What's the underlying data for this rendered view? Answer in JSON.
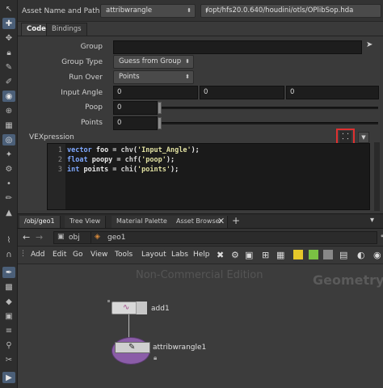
{
  "header": {
    "asset_label": "Asset Name and Path",
    "asset_name": "attribwrangle",
    "asset_path": "/opt/hfs20.0.640/houdini/otls/OPlibSop.hda"
  },
  "tabs": [
    {
      "label": "Code",
      "active": true
    },
    {
      "label": "Bindings",
      "active": false
    }
  ],
  "params": {
    "group_label": "Group",
    "group_value": "",
    "group_type_label": "Group Type",
    "group_type_value": "Guess from Group",
    "run_over_label": "Run Over",
    "run_over_value": "Points",
    "input_angle_label": "Input Angle",
    "input_angle_values": [
      "0",
      "0",
      "0"
    ],
    "poop_label": "Poop",
    "poop_value": "0",
    "points_label": "Points",
    "points_value": "0"
  },
  "vex": {
    "label": "VEXpression",
    "lines": [
      {
        "num": "1",
        "kw": "vector",
        "rest_a": " foo = ",
        "fn": "chv",
        "str": "'Input_Angle'",
        "rest_b": ");"
      },
      {
        "num": "2",
        "kw": "float",
        "rest_a": " poopy = ",
        "fn": "chf",
        "str": "'poop'",
        "rest_b": ");"
      },
      {
        "num": "3",
        "kw": "int",
        "rest_a": " points = ",
        "fn": "chi",
        "str": "'points'",
        "rest_b": ");"
      }
    ]
  },
  "network": {
    "tabs": [
      "/obj/geo1",
      "Tree View",
      "Material Palette",
      "Asset Browser"
    ],
    "path": [
      "obj",
      "geo1"
    ],
    "menu": [
      "Add",
      "Edit",
      "Go",
      "View",
      "Tools",
      "Layout",
      "Labs",
      "Help"
    ],
    "watermark": "Non-Commercial Edition",
    "context_label": "Geometry",
    "nodes": [
      {
        "name": "add1"
      },
      {
        "name": "attribwrangle1"
      }
    ]
  },
  "colors": {
    "highlight_box": "#e03030",
    "accent": "#4b5f78"
  }
}
